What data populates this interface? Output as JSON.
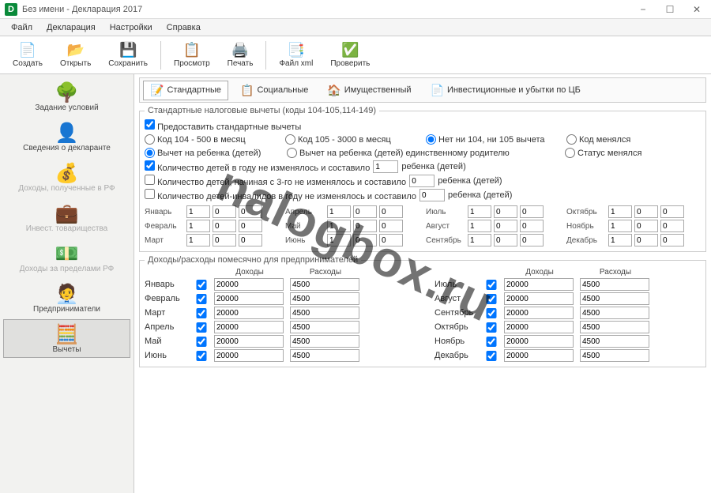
{
  "window": {
    "title": "Без имени - Декларация 2017"
  },
  "menu": {
    "file": "Файл",
    "decl": "Декларация",
    "settings": "Настройки",
    "help": "Справка"
  },
  "toolbar": {
    "create": "Создать",
    "open": "Открыть",
    "save": "Сохранить",
    "preview": "Просмотр",
    "print": "Печать",
    "xml": "Файл xml",
    "check": "Проверить"
  },
  "sidebar": {
    "cond": "Задание условий",
    "declarant": "Сведения о декларанте",
    "income_rf": "Доходы, полученные в РФ",
    "invest": "Инвест. товарищества",
    "income_abroad": "Доходы за пределами РФ",
    "entrepreneur": "Предприниматели",
    "deductions": "Вычеты"
  },
  "tabs": {
    "standard": "Стандартные",
    "social": "Социальные",
    "property": "Имущественный",
    "invest_loss": "Инвестиционные и убытки по ЦБ"
  },
  "group1": {
    "legend": "Стандартные налоговые вычеты (коды 104-105,114-149)",
    "provide": "Предоставить стандартные вычеты",
    "r104": "Код 104 - 500 в месяц",
    "r105": "Код 105 - 3000 в месяц",
    "rNone": "Нет ни 104, ни 105 вычета",
    "rCodeChanged": "Код менялся",
    "rChild": "Вычет на ребенка (детей)",
    "rChildSingle": "Вычет на ребенка (детей) единственному родителю",
    "rStatusChanged": "Статус менялся",
    "cnt1": "Количество детей в году не изменялось и составило",
    "cnt2": "Количество детей, начиная с 3-го не изменялось и составило",
    "cnt3": "Количество детей-инвалидов в году не изменялось и составило",
    "childLabel": "ребенка (детей)",
    "cnt1val": "1",
    "cnt2val": "0",
    "cnt3val": "0"
  },
  "monthsA": {
    "v1": "1",
    "v2": "0",
    "v3": "0"
  },
  "monthNames": {
    "jan": "Январь",
    "feb": "Февраль",
    "mar": "Март",
    "apr": "Апрель",
    "may": "Май",
    "jun": "Июнь",
    "jul": "Июль",
    "aug": "Август",
    "sep": "Сентябрь",
    "oct": "Октябрь",
    "nov": "Ноябрь",
    "dec": "Декабрь"
  },
  "group2": {
    "legend": "Доходы/расходы помесячно для предпринимателей",
    "income": "Доходы",
    "expense": "Расходы",
    "val_income": "20000",
    "val_expense": "4500"
  },
  "watermark": "nalogbox.ru"
}
